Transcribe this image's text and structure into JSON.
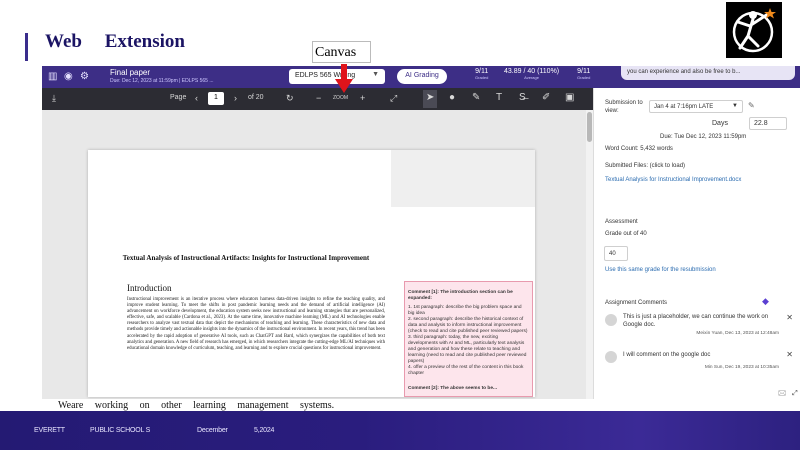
{
  "slide": {
    "title": "Web Extension",
    "canvas_label": "Canvas",
    "caption": "Weare working on other learning management systems.",
    "footer": {
      "org": "EVERETT",
      "school": "PUBLIC SCHOOL S",
      "month": "December",
      "day_year": "5,2024"
    }
  },
  "speedgrader": {
    "file_name": "Final paper",
    "due_line": "Due: Dec 12, 2023 at 11:59pm  |  EDLPS 565 ...",
    "course_select": "EDLPS 565 Writing",
    "ai_button": "AI Grading",
    "stats": [
      {
        "value": "9/11",
        "label": "Graded"
      },
      {
        "value": "43.89 / 40 (110%)",
        "label": "Average"
      },
      {
        "value": "9/11",
        "label": "Graded"
      }
    ],
    "notice": "you can experience and also be free to b...",
    "toolbar": {
      "page_label": "Page",
      "page_value": "1",
      "page_of": "of 20",
      "zoom_label": "ZOOM"
    },
    "document": {
      "title": "Textual Analysis of Instructional Artifacts: Insights for Instructional Improvement",
      "intro_heading": "Introduction",
      "body": "Instructional improvement is an iterative process where educators harness data-driven insights to refine the teaching quality, and improve student learning. To meet the shifts in post pandemic learning needs and the demand of artificial intelligence (AI) advancement on workforce development, the education system seeks new instructional and learning strategies that are personalized, effective, safe, and scalable (Cardona et al., 2023). At the same time, innovative machine learning (ML) and AI technologies enable researchers to analyze vast textual data that depict the mechanisms of teaching and learning. These characteristics of new data and methods provide timely and actionable insights into the dynamics of the instructional environment. In recent years, this trend has been accelerated by the rapid adoption of generative AI tools, such as ChatGPT and Bard, which synergizes the capabilities of both text analytics and generation. A new field of research has emerged, in which researchers integrate the cutting-edge ML/AI techniques with educational domain knowledge of curriculum, teaching, and learning and to explore crucial questions for instructional improvement.",
      "comment_title": "Comment [1]: The introduction section can be expanded:",
      "comment_body": "1. 1st paragraph: describe the big problem space and big idea\n2. second paragraph: describe the historical context of data and analysis to inform instructional improvement (check to read and cite published peer reviewed papers)\n3. third paragraph: today, the new, exciting developments with AI and ML, particularly text analysis and generation and how these relate to teaching and learning (need to read and cite published peer reviewed papers)\n4. offer a preview of the rest of the content in this book chapter",
      "comment_next": "Comment [2]: The above seems to be..."
    },
    "right_panel": {
      "submission_label": "Submission to view:",
      "submission_value": "Jan 4 at 7:16pm LATE",
      "days_label": "Days",
      "days_value": "22.8",
      "due_text": "Due: Tue Dec 12, 2023 11:59pm",
      "word_count": "Word Count: 5,432 words",
      "files_label": "Submitted Files: (click to load)",
      "file_link": "Textual Analysis for Instructional Improvement.docx",
      "assessment_label": "Assessment",
      "grade_label": "Grade out of 40",
      "grade_value": "40",
      "same_grade_link": "Use this same grade for the resubmission",
      "comments_label": "Assignment Comments",
      "comments": [
        {
          "text": "This is just a placeholder, we can continue the work on Google doc.",
          "meta": "Meixin Yuan, Dec 13, 2023 at 12:48am"
        },
        {
          "text": "I will comment on the google doc",
          "meta": "Min Sun, Dec 19, 2023 at 10:35am"
        }
      ]
    }
  },
  "colors": {
    "canvas_purple": "#3d2e86",
    "toolbar_dark": "#2c2c33",
    "comment_pink": "#fde5ec",
    "arrow_red": "#e0141b",
    "footer_blue": "#2a1d7e"
  }
}
